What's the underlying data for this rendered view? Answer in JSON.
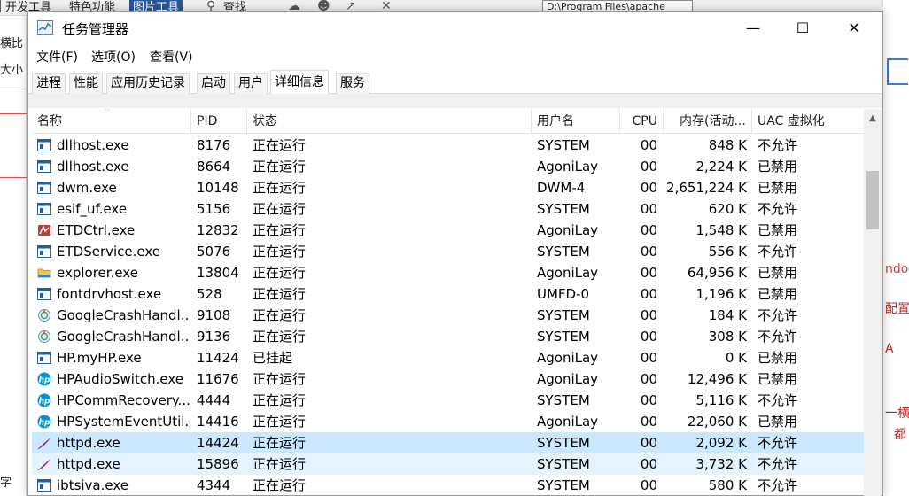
{
  "background": {
    "ribbon_tabs": [
      "开发工具",
      "特色功能",
      "图片工具"
    ],
    "search_label": "查找",
    "path_text": "D:\\Program Files\\apache",
    "left_labels": [
      "横比",
      "大小",
      "字"
    ],
    "right_labels": [
      "ndow",
      "配置",
      "A",
      "一横",
      "都"
    ]
  },
  "window": {
    "title": "任务管理器",
    "minimize": "—",
    "maximize": "☐",
    "close": "✕"
  },
  "menu": [
    "文件(F)",
    "选项(O)",
    "查看(V)"
  ],
  "tabs": [
    "进程",
    "性能",
    "应用历史记录",
    "启动",
    "用户",
    "详细信息",
    "服务"
  ],
  "active_tab": "详细信息",
  "columns": {
    "name": "名称",
    "pid": "PID",
    "status": "状态",
    "user": "用户名",
    "cpu": "CPU",
    "memory": "内存(活动...",
    "uac": "UAC 虚拟化"
  },
  "rows": [
    {
      "icon": "generic-app-icon",
      "name": "dllhost.exe",
      "pid": "8176",
      "status": "正在运行",
      "user": "SYSTEM",
      "cpu": "00",
      "memory": "848 K",
      "uac": "不允许"
    },
    {
      "icon": "generic-app-icon",
      "name": "dllhost.exe",
      "pid": "8664",
      "status": "正在运行",
      "user": "AgoniLay",
      "cpu": "00",
      "memory": "2,224 K",
      "uac": "已禁用"
    },
    {
      "icon": "generic-app-icon",
      "name": "dwm.exe",
      "pid": "10148",
      "status": "正在运行",
      "user": "DWM-4",
      "cpu": "00",
      "memory": "2,651,224 K",
      "uac": "已禁用"
    },
    {
      "icon": "generic-app-icon",
      "name": "esif_uf.exe",
      "pid": "5156",
      "status": "正在运行",
      "user": "SYSTEM",
      "cpu": "00",
      "memory": "620 K",
      "uac": "不允许"
    },
    {
      "icon": "etd-ctrl-icon",
      "name": "ETDCtrl.exe",
      "pid": "12832",
      "status": "正在运行",
      "user": "AgoniLay",
      "cpu": "00",
      "memory": "1,548 K",
      "uac": "已禁用"
    },
    {
      "icon": "generic-app-icon",
      "name": "ETDService.exe",
      "pid": "5076",
      "status": "正在运行",
      "user": "SYSTEM",
      "cpu": "00",
      "memory": "556 K",
      "uac": "不允许"
    },
    {
      "icon": "folder-icon",
      "name": "explorer.exe",
      "pid": "13804",
      "status": "正在运行",
      "user": "AgoniLay",
      "cpu": "00",
      "memory": "64,956 K",
      "uac": "已禁用"
    },
    {
      "icon": "generic-app-icon",
      "name": "fontdrvhost.exe",
      "pid": "528",
      "status": "正在运行",
      "user": "UMFD-0",
      "cpu": "00",
      "memory": "1,196 K",
      "uac": "已禁用"
    },
    {
      "icon": "google-update-icon",
      "name": "GoogleCrashHandl...",
      "pid": "9108",
      "status": "正在运行",
      "user": "SYSTEM",
      "cpu": "00",
      "memory": "184 K",
      "uac": "不允许"
    },
    {
      "icon": "google-update-icon",
      "name": "GoogleCrashHandl...",
      "pid": "9136",
      "status": "正在运行",
      "user": "SYSTEM",
      "cpu": "00",
      "memory": "308 K",
      "uac": "不允许"
    },
    {
      "icon": "generic-app-icon",
      "name": "HP.myHP.exe",
      "pid": "11424",
      "status": "已挂起",
      "user": "AgoniLay",
      "cpu": "00",
      "memory": "0 K",
      "uac": "已禁用"
    },
    {
      "icon": "hp-logo-icon",
      "name": "HPAudioSwitch.exe",
      "pid": "11676",
      "status": "正在运行",
      "user": "AgoniLay",
      "cpu": "00",
      "memory": "12,496 K",
      "uac": "已禁用"
    },
    {
      "icon": "hp-logo-icon",
      "name": "HPCommRecovery....",
      "pid": "4444",
      "status": "正在运行",
      "user": "SYSTEM",
      "cpu": "00",
      "memory": "5,116 K",
      "uac": "不允许"
    },
    {
      "icon": "hp-logo-icon",
      "name": "HPSystemEventUtil...",
      "pid": "14416",
      "status": "正在运行",
      "user": "AgoniLay",
      "cpu": "00",
      "memory": "22,060 K",
      "uac": "已禁用"
    },
    {
      "icon": "apache-feather-icon",
      "name": "httpd.exe",
      "pid": "14424",
      "status": "正在运行",
      "user": "SYSTEM",
      "cpu": "00",
      "memory": "2,092 K",
      "uac": "不允许",
      "selected": true
    },
    {
      "icon": "apache-feather-icon",
      "name": "httpd.exe",
      "pid": "15896",
      "status": "正在运行",
      "user": "SYSTEM",
      "cpu": "00",
      "memory": "3,732 K",
      "uac": "不允许",
      "hover": true
    },
    {
      "icon": "generic-app-icon",
      "name": "ibtsiva.exe",
      "pid": "4344",
      "status": "正在运行",
      "user": "SYSTEM",
      "cpu": "00",
      "memory": "580 K",
      "uac": "不允许"
    }
  ],
  "colors": {
    "selected_row": "#cce8ff",
    "hover_row": "#e5f3ff",
    "hp_blue": "#0096d6",
    "apache_purple": "#c0208a",
    "generic_icon_blue": "#1f5fa8"
  }
}
